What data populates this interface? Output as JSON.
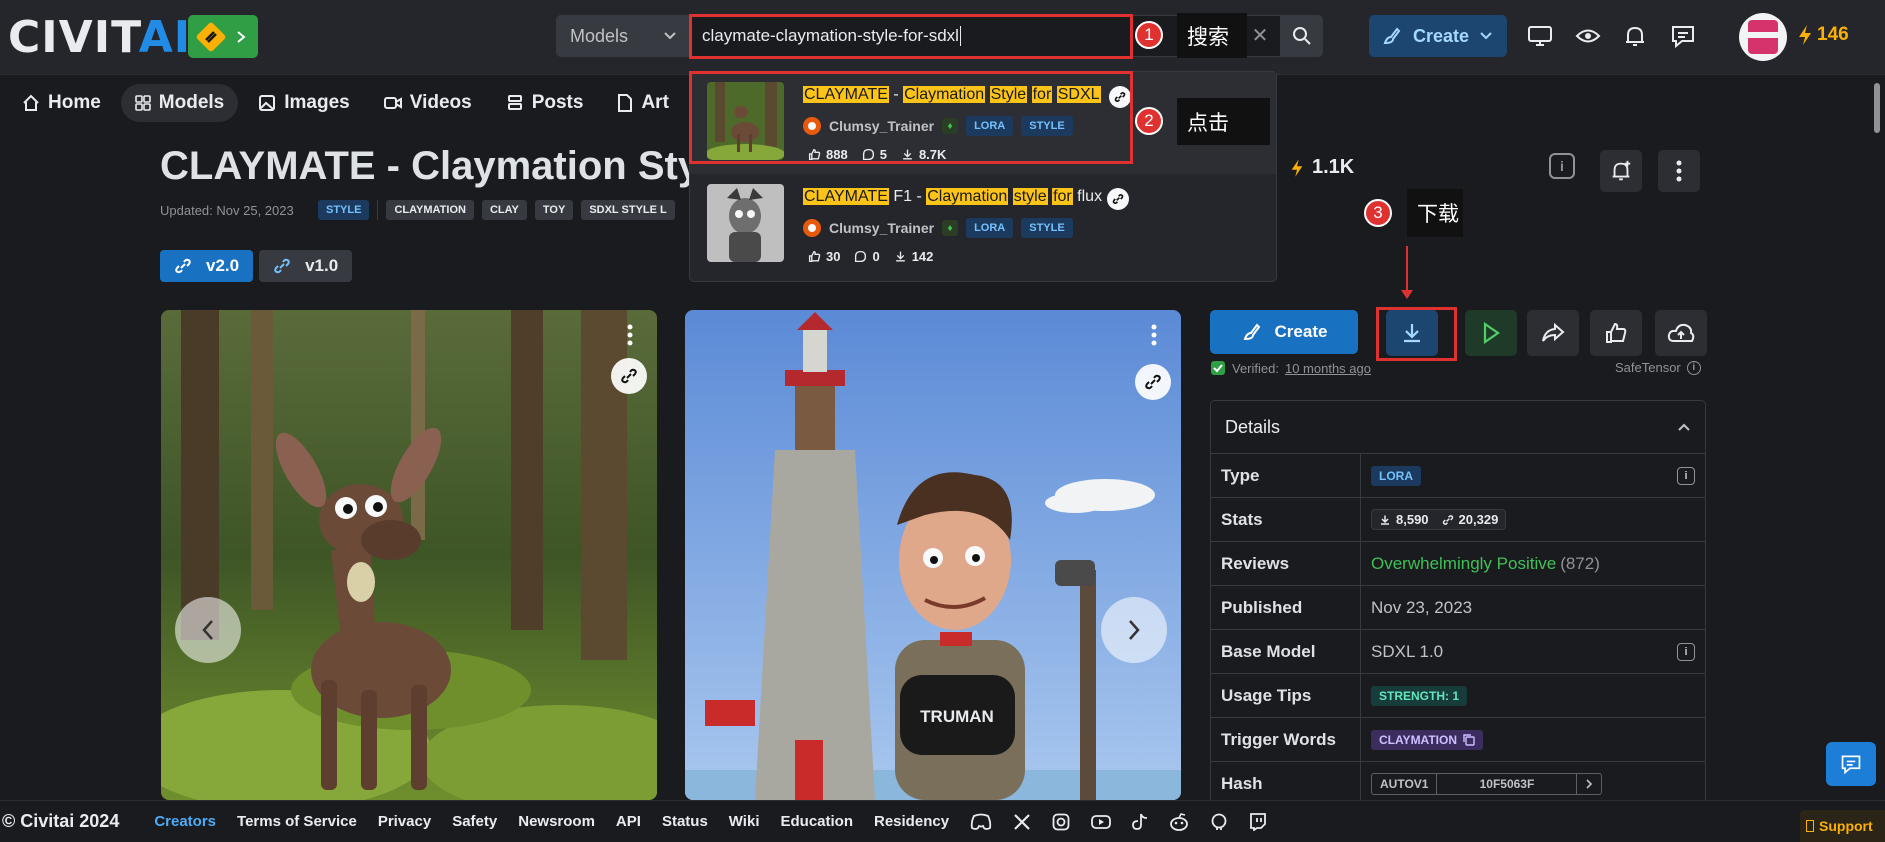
{
  "header": {
    "logo_main": "CIVIT",
    "logo_ai": "AI",
    "search_category": "Models",
    "search_value": "claymate-claymation-style-for-sdxl",
    "create_label": "Create",
    "buzz_count": "146"
  },
  "nav": {
    "items": [
      {
        "label": "Home",
        "icon": "home-icon"
      },
      {
        "label": "Models",
        "icon": "grid-icon"
      },
      {
        "label": "Images",
        "icon": "image-icon"
      },
      {
        "label": "Videos",
        "icon": "video-icon"
      },
      {
        "label": "Posts",
        "icon": "layers-icon"
      },
      {
        "label": "Art",
        "icon": "document-icon"
      }
    ]
  },
  "model": {
    "title": "CLAYMATE - Claymation Styl",
    "updated": "Updated: Nov 25, 2023",
    "tags": [
      "STYLE",
      "CLAYMATION",
      "CLAY",
      "TOY",
      "SDXL STYLE L"
    ],
    "versions": [
      "v2.0",
      "v1.0"
    ],
    "buzz_total": "1.1K"
  },
  "dropdown": {
    "results": [
      {
        "title_parts": [
          {
            "t": "CLAYMATE",
            "h": true
          },
          {
            "t": " - ",
            "h": false
          },
          {
            "t": "Claymation",
            "h": true
          },
          {
            "t": " ",
            "h": false
          },
          {
            "t": "Style",
            "h": true
          },
          {
            "t": " ",
            "h": false
          },
          {
            "t": "for",
            "h": true
          },
          {
            "t": " ",
            "h": false
          },
          {
            "t": "SDXL",
            "h": true
          }
        ],
        "user": "Clumsy_Trainer",
        "chips": [
          "LORA",
          "STYLE"
        ],
        "likes": "888",
        "comments": "5",
        "downloads": "8.7K"
      },
      {
        "title_parts": [
          {
            "t": "CLAYMATE",
            "h": true
          },
          {
            "t": " F1 - ",
            "h": false
          },
          {
            "t": "Claymation",
            "h": true
          },
          {
            "t": " ",
            "h": false
          },
          {
            "t": "style",
            "h": true
          },
          {
            "t": " ",
            "h": false
          },
          {
            "t": "for",
            "h": true
          },
          {
            "t": " flux",
            "h": false
          }
        ],
        "user": "Clumsy_Trainer",
        "chips": [
          "LORA",
          "STYLE"
        ],
        "likes": "30",
        "comments": "0",
        "downloads": "142"
      }
    ]
  },
  "annotations": {
    "step1_num": "1",
    "step1_text": "搜索",
    "step2_num": "2",
    "step2_text": "点击",
    "step3_num": "3",
    "step3_text": "下载"
  },
  "right_panel": {
    "create_label": "Create",
    "verified_label": "Verified:",
    "verified_time": "10 months ago",
    "file_format": "SafeTensor",
    "details_title": "Details",
    "rows": {
      "type_label": "Type",
      "type_value": "LORA",
      "stats_label": "Stats",
      "stats_downloads": "8,590",
      "stats_generations": "20,329",
      "reviews_label": "Reviews",
      "reviews_value": "Overwhelmingly Positive",
      "reviews_count": "(872)",
      "published_label": "Published",
      "published_value": "Nov 23, 2023",
      "base_model_label": "Base Model",
      "base_model_value": "SDXL 1.0",
      "usage_tips_label": "Usage Tips",
      "usage_tips_value": "STRENGTH: 1",
      "trigger_words_label": "Trigger Words",
      "trigger_words_value": "CLAYMATION",
      "hash_label": "Hash",
      "hash_type": "AUTOV1",
      "hash_value": "10F5063F"
    }
  },
  "images": {
    "second_sign": "TRUMAN"
  },
  "footer": {
    "copyright": "© Civitai 2024",
    "links": [
      "Creators",
      "Terms of Service",
      "Privacy",
      "Safety",
      "Newsroom",
      "API",
      "Status",
      "Wiki",
      "Education",
      "Residency"
    ],
    "support": "Support"
  },
  "colors": {
    "accent_blue": "#228be6",
    "highlight_yellow": "#fcc419",
    "annotation_red": "#e03131",
    "buzz_orange": "#fab005",
    "positive_green": "#40c057"
  }
}
